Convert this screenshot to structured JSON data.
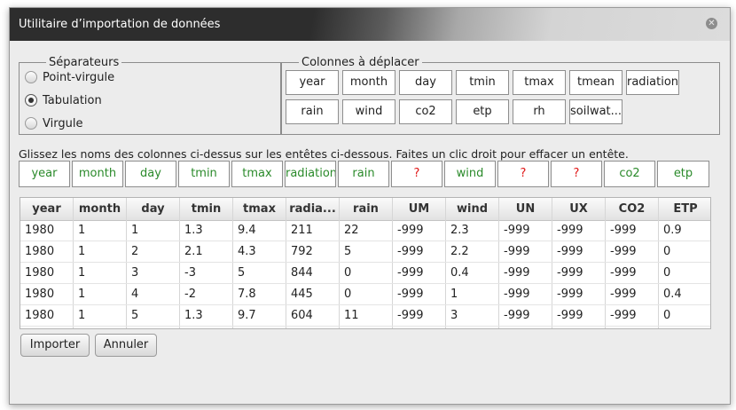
{
  "window": {
    "title": "Utilitaire d’importation de données"
  },
  "separators": {
    "legend": "Séparateurs",
    "options": [
      {
        "label": "Point-virgule",
        "selected": false
      },
      {
        "label": "Tabulation",
        "selected": true
      },
      {
        "label": "Virgule",
        "selected": false
      }
    ]
  },
  "columns_to_move": {
    "legend": "Colonnes à déplacer",
    "items": [
      "year",
      "month",
      "day",
      "tmin",
      "tmax",
      "tmean",
      "radiation",
      "rain",
      "wind",
      "co2",
      "etp",
      "rh",
      "soilwat..."
    ]
  },
  "hint": "Glissez les noms des colonnes ci-dessus sur les entêtes ci-dessous. Faites un clic droit pour effacer un entête.",
  "header_slots": [
    {
      "label": "year",
      "assigned": true
    },
    {
      "label": "month",
      "assigned": true
    },
    {
      "label": "day",
      "assigned": true
    },
    {
      "label": "tmin",
      "assigned": true
    },
    {
      "label": "tmax",
      "assigned": true
    },
    {
      "label": "radiation",
      "assigned": true
    },
    {
      "label": "rain",
      "assigned": true
    },
    {
      "label": "?",
      "assigned": false
    },
    {
      "label": "wind",
      "assigned": true
    },
    {
      "label": "?",
      "assigned": false
    },
    {
      "label": "?",
      "assigned": false
    },
    {
      "label": "co2",
      "assigned": true
    },
    {
      "label": "etp",
      "assigned": true
    }
  ],
  "table": {
    "headers": [
      "year",
      "month",
      "day",
      "tmin",
      "tmax",
      "radia...",
      "rain",
      "UM",
      "wind",
      "UN",
      "UX",
      "CO2",
      "ETP"
    ],
    "rows": [
      [
        "1980",
        "1",
        "1",
        "1.3",
        "9.4",
        "211",
        "22",
        "-999",
        "2.3",
        "-999",
        "-999",
        "-999",
        "0.9"
      ],
      [
        "1980",
        "1",
        "2",
        "2.1",
        "4.3",
        "792",
        "5",
        "-999",
        "2.2",
        "-999",
        "-999",
        "-999",
        "0"
      ],
      [
        "1980",
        "1",
        "3",
        "-3",
        "5",
        "844",
        "0",
        "-999",
        "0.4",
        "-999",
        "-999",
        "-999",
        "0"
      ],
      [
        "1980",
        "1",
        "4",
        "-2",
        "7.8",
        "445",
        "0",
        "-999",
        "1",
        "-999",
        "-999",
        "-999",
        "0.4"
      ],
      [
        "1980",
        "1",
        "5",
        "1.3",
        "9.7",
        "604",
        "11",
        "-999",
        "3",
        "-999",
        "-999",
        "-999",
        "0"
      ],
      [
        "",
        "",
        "",
        "",
        "",
        "",
        "",
        "",
        "",
        "",
        "",
        "",
        ""
      ]
    ]
  },
  "buttons": {
    "import": "Importer",
    "cancel": "Annuler"
  },
  "colors": {
    "assigned": "#2a8a2a",
    "unassigned": "#e01515"
  },
  "icons": {
    "close": "close-icon"
  }
}
